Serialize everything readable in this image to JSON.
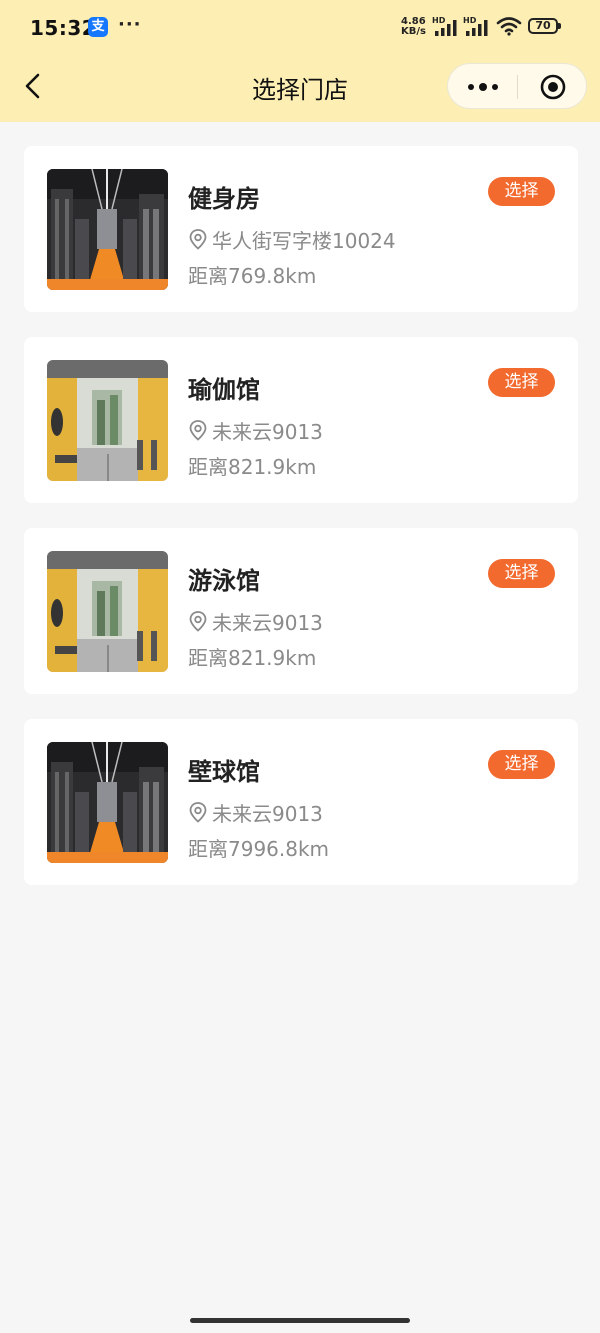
{
  "status_bar": {
    "time": "15:32",
    "app_badge": "支",
    "more_dots": "···",
    "net_speed_value": "4.86",
    "net_speed_unit": "KB/s",
    "sig1_label": "HD",
    "sig2_label": "HD",
    "battery": "70"
  },
  "nav": {
    "title": "选择门店"
  },
  "stores": [
    {
      "name": "健身房",
      "address": "华人街写字楼10024",
      "distance": "距离769.8km",
      "action": "选择",
      "thumb": "gym-dark"
    },
    {
      "name": "瑜伽馆",
      "address": "未来云9013",
      "distance": "距离821.9km",
      "action": "选择",
      "thumb": "gym-yellow"
    },
    {
      "name": "游泳馆",
      "address": "未来云9013",
      "distance": "距离821.9km",
      "action": "选择",
      "thumb": "gym-yellow"
    },
    {
      "name": "壁球馆",
      "address": "未来云9013",
      "distance": "距离7996.8km",
      "action": "选择",
      "thumb": "gym-dark"
    }
  ],
  "colors": {
    "header_bg": "#fdefb4",
    "accent": "#f26a2e",
    "page_bg": "#f6f6f6",
    "muted_text": "#8a8a8a"
  }
}
